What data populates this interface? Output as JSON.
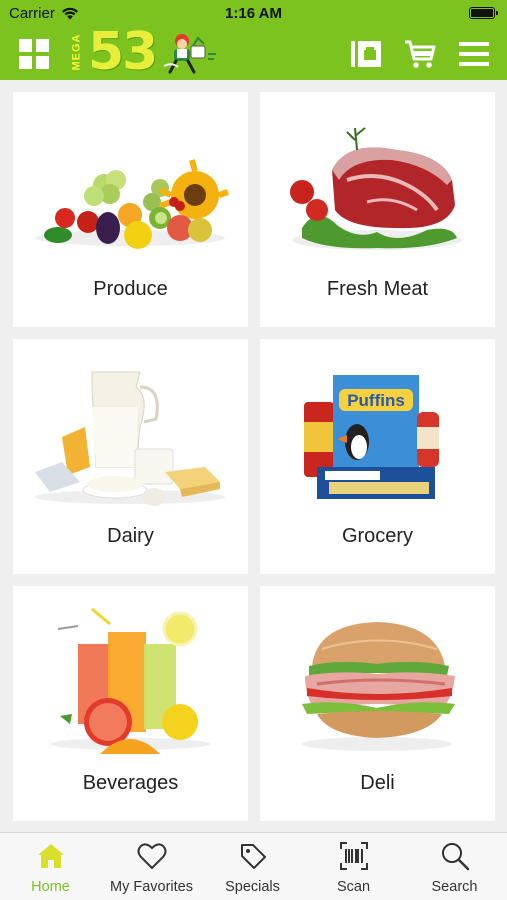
{
  "status_bar": {
    "carrier": "Carrier",
    "time": "1:16 AM"
  },
  "header": {
    "logo_mega": "MEGA",
    "logo_number": "53",
    "icons": [
      "grid-icon",
      "store-card-icon",
      "cart-icon",
      "menu-icon"
    ]
  },
  "categories": [
    {
      "label": "Produce",
      "icon": "produce-image"
    },
    {
      "label": "Fresh Meat",
      "icon": "fresh-meat-image"
    },
    {
      "label": "Dairy",
      "icon": "dairy-image"
    },
    {
      "label": "Grocery",
      "icon": "grocery-image"
    },
    {
      "label": "Beverages",
      "icon": "beverages-image"
    },
    {
      "label": "Deli",
      "icon": "deli-image"
    }
  ],
  "tabs": [
    {
      "label": "Home",
      "icon": "home-icon",
      "active": true
    },
    {
      "label": "My Favorites",
      "icon": "heart-icon",
      "active": false
    },
    {
      "label": "Specials",
      "icon": "tag-icon",
      "active": false
    },
    {
      "label": "Scan",
      "icon": "barcode-icon",
      "active": false
    },
    {
      "label": "Search",
      "icon": "search-icon",
      "active": false
    }
  ],
  "colors": {
    "brand_green": "#7dc31f",
    "logo_yellow": "#e8ef3a",
    "background": "#efefef"
  }
}
